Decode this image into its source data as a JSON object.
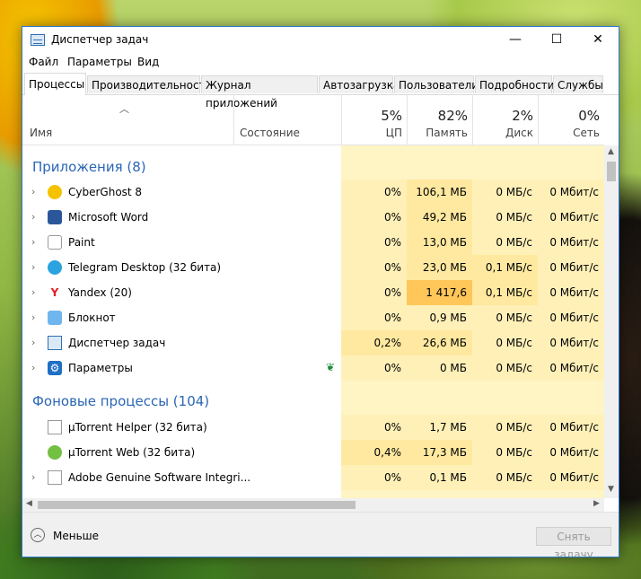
{
  "window": {
    "title": "Диспетчер задач",
    "controls": {
      "minimize": "—",
      "maximize": "☐",
      "close": "✕"
    }
  },
  "menu": [
    "Файл",
    "Параметры",
    "Вид"
  ],
  "tabs": [
    "Процессы",
    "Производительность",
    "Журнал приложений",
    "Автозагрузка",
    "Пользователи",
    "Подробности",
    "Службы"
  ],
  "header": {
    "name": "Имя",
    "state": "Состояние",
    "columns": [
      {
        "pct": "5%",
        "label": "ЦП"
      },
      {
        "pct": "82%",
        "label": "Память"
      },
      {
        "pct": "2%",
        "label": "Диск"
      },
      {
        "pct": "0%",
        "label": "Сеть"
      }
    ]
  },
  "sections": {
    "apps": "Приложения (8)",
    "background": "Фоновые процессы (104)"
  },
  "rows": [
    {
      "name": "CyberGhost 8",
      "icon": "cyberghost-icon",
      "cpu": "0%",
      "mem": "106,1 МБ",
      "disk": "0 МБ/с",
      "net": "0 Мбит/с"
    },
    {
      "name": "Microsoft Word",
      "icon": "word-icon",
      "cpu": "0%",
      "mem": "49,2 МБ",
      "disk": "0 МБ/с",
      "net": "0 Мбит/с"
    },
    {
      "name": "Paint",
      "icon": "paint-icon",
      "cpu": "0%",
      "mem": "13,0 МБ",
      "disk": "0 МБ/с",
      "net": "0 Мбит/с"
    },
    {
      "name": "Telegram Desktop (32 бита)",
      "icon": "telegram-icon",
      "cpu": "0%",
      "mem": "23,0 МБ",
      "disk": "0,1 МБ/с",
      "net": "0 Мбит/с"
    },
    {
      "name": "Yandex (20)",
      "icon": "yandex-icon",
      "cpu": "0%",
      "mem": "1 417,6 МБ",
      "disk": "0,1 МБ/с",
      "net": "0 Мбит/с"
    },
    {
      "name": "Блокнот",
      "icon": "notepad-icon",
      "cpu": "0%",
      "mem": "0,9 МБ",
      "disk": "0 МБ/с",
      "net": "0 Мбит/с"
    },
    {
      "name": "Диспетчер задач",
      "icon": "task-manager-icon",
      "cpu": "0,2%",
      "mem": "26,6 МБ",
      "disk": "0 МБ/с",
      "net": "0 Мбит/с"
    },
    {
      "name": "Параметры",
      "icon": "settings-gear-icon",
      "cpu": "0%",
      "mem": "0 МБ",
      "disk": "0 МБ/с",
      "net": "0 Мбит/с"
    },
    {
      "name": "µTorrent Helper (32 бита)",
      "icon": "utorrent-helper-icon",
      "cpu": "0%",
      "mem": "1,7 МБ",
      "disk": "0 МБ/с",
      "net": "0 Мбит/с"
    },
    {
      "name": "µTorrent Web (32 бита)",
      "icon": "utorrent-web-icon",
      "cpu": "0,4%",
      "mem": "17,3 МБ",
      "disk": "0 МБ/с",
      "net": "0 Мбит/с"
    },
    {
      "name": "Adobe Genuine Software Integri...",
      "icon": "adobe-icon",
      "cpu": "0%",
      "mem": "0,1 МБ",
      "disk": "0 МБ/с",
      "net": "0 Мбит/с"
    }
  ],
  "footer": {
    "less": "Меньше",
    "end_task": "Снять задачу"
  },
  "colors": {
    "accent": "#2a66b5",
    "metric_bg": "#fff4c4",
    "metric_mid": "#ffe9a0",
    "metric_high": "#ffc65a"
  }
}
